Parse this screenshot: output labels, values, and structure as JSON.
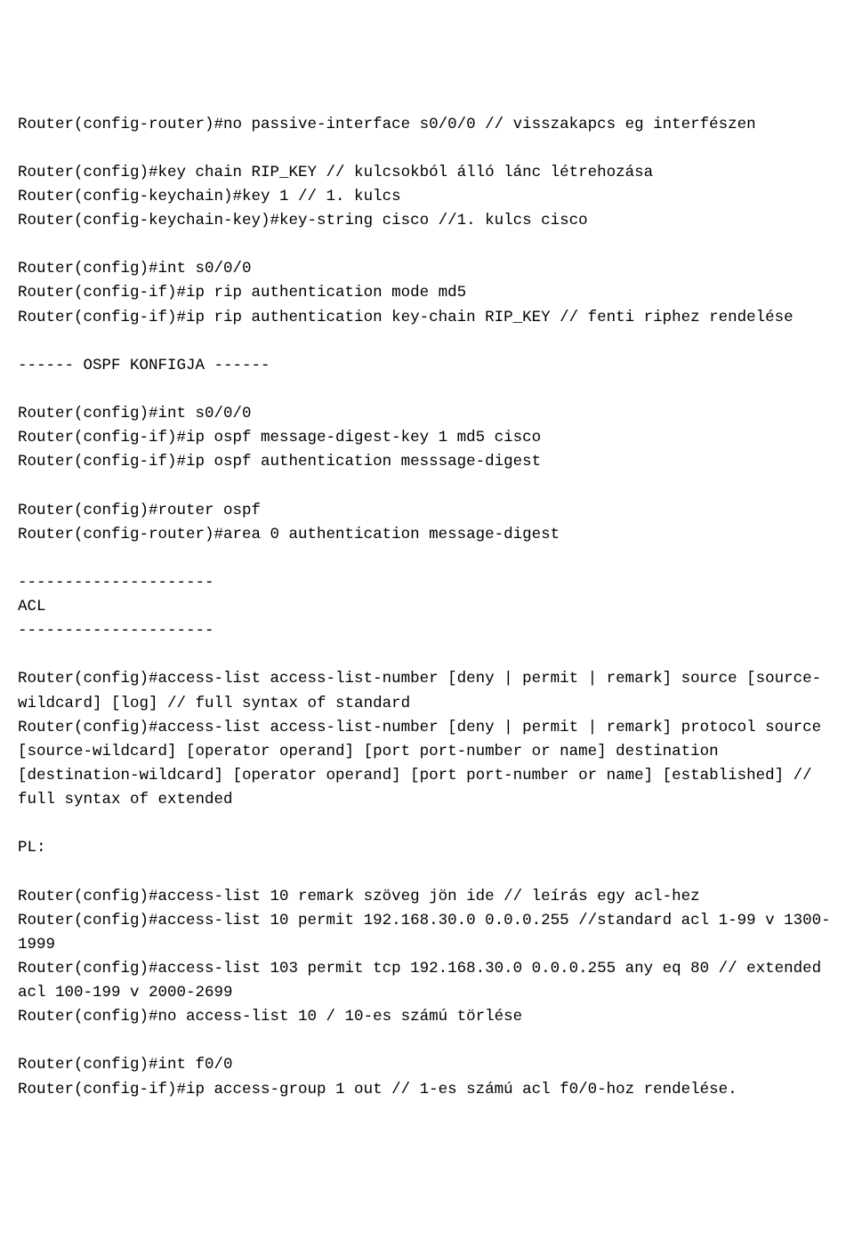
{
  "lines": [
    "Router(config-router)#no passive-interface s0/0/0 // visszakapcs eg interfészen",
    "",
    "Router(config)#key chain RIP_KEY // kulcsokból álló lánc létrehozása",
    "Router(config-keychain)#key 1 // 1. kulcs",
    "Router(config-keychain-key)#key-string cisco //1. kulcs cisco",
    "",
    "Router(config)#int s0/0/0",
    "Router(config-if)#ip rip authentication mode md5",
    "Router(config-if)#ip rip authentication key-chain RIP_KEY // fenti riphez rendelése",
    "",
    "------ OSPF KONFIGJA ------",
    "",
    "Router(config)#int s0/0/0",
    "Router(config-if)#ip ospf message-digest-key 1 md5 cisco",
    "Router(config-if)#ip ospf authentication messsage-digest",
    "",
    "Router(config)#router ospf",
    "Router(config-router)#area 0 authentication message-digest",
    "",
    "---------------------",
    "ACL",
    "---------------------",
    "",
    "Router(config)#access-list access-list-number [deny | permit | remark] source [source-wildcard] [log] // full syntax of standard",
    "Router(config)#access-list access-list-number [deny | permit | remark] protocol source [source-wildcard] [operator operand] [port port-number or name] destination [destination-wildcard] [operator operand] [port port-number or name] [established] // full syntax of extended",
    "",
    "PL:",
    "",
    "Router(config)#access-list 10 remark szöveg jön ide // leírás egy acl-hez",
    "Router(config)#access-list 10 permit 192.168.30.0 0.0.0.255 //standard acl 1-99 v 1300-1999",
    "Router(config)#access-list 103 permit tcp 192.168.30.0 0.0.0.255 any eq 80 // extended acl 100-199 v 2000-2699",
    "Router(config)#no access-list 10 / 10-es számú törlése",
    "",
    "Router(config)#int f0/0",
    "Router(config-if)#ip access-group 1 out // 1-es számú acl f0/0-hoz rendelése."
  ]
}
